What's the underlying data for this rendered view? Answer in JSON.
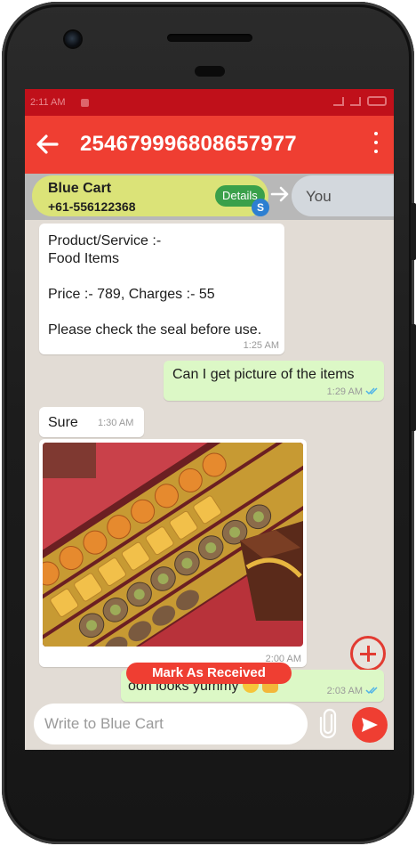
{
  "status_bar": {
    "time": "2:11 AM"
  },
  "app_bar": {
    "title": "25467999680865797​7"
  },
  "route": {
    "merchant_name": "Blue Cart",
    "merchant_phone": "+61-556122368",
    "details_label": "Details",
    "badge_letter": "S",
    "recipient_label": "You"
  },
  "messages": [
    {
      "direction": "in",
      "text": "Product/Service :-\nFood Items\n\nPrice :- 789, Charges :- 55\n\nPlease check the seal before use.",
      "time": "1:25 AM"
    },
    {
      "direction": "out",
      "text": "Can I get picture of the items",
      "time": "1:29 AM"
    },
    {
      "direction": "in",
      "text": "Sure",
      "time": "1:30 AM"
    },
    {
      "direction": "in",
      "type": "image",
      "time": "2:00 AM"
    },
    {
      "direction": "out",
      "text": "ooh looks yummy",
      "time": "2:03 AM"
    }
  ],
  "mark_received_label": "Mark As Received",
  "composer": {
    "placeholder": "Write to Blue Cart"
  },
  "icons": {
    "back": "arrow-left-icon",
    "menu": "more-vertical-icon",
    "arrow": "arrow-right-icon",
    "add": "plus-circle-icon",
    "attach": "paperclip-icon",
    "send": "send-icon"
  },
  "colors": {
    "status_bar": "#c0101a",
    "app_bar": "#ef3e32",
    "merchant_pill": "#dbe378",
    "details_button": "#3aa04a",
    "outgoing_bubble": "#dcf8c6",
    "chat_background": "#e2dcd5"
  }
}
